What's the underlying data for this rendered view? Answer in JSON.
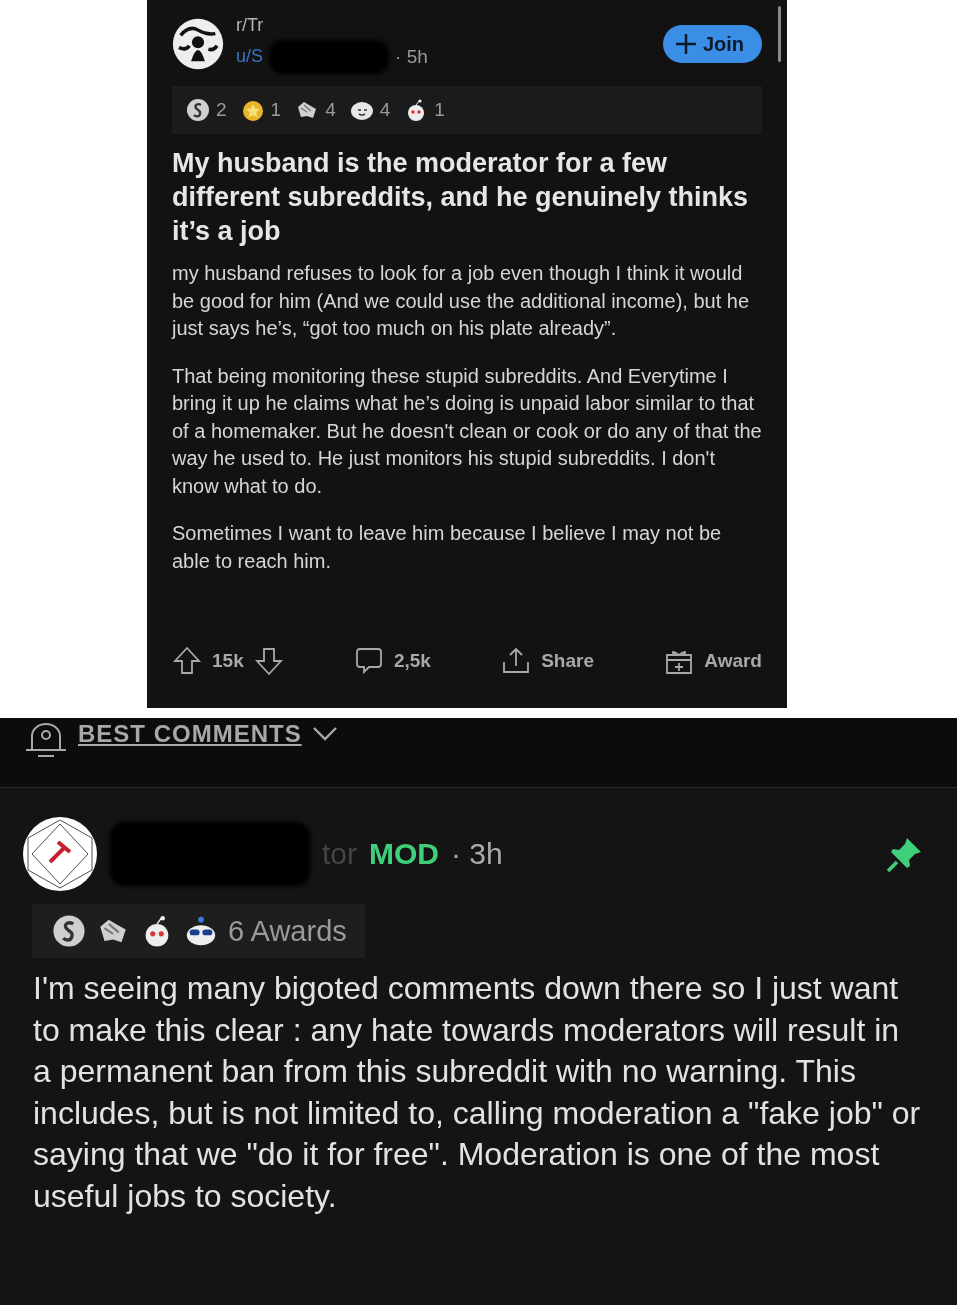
{
  "post": {
    "subreddit": "r/Tr",
    "author": "u/S",
    "time": "· 5h",
    "join_button": "Join",
    "awards": [
      {
        "kind": "silver",
        "count": "2"
      },
      {
        "kind": "star",
        "count": "1"
      },
      {
        "kind": "hands",
        "count": "4"
      },
      {
        "kind": "face",
        "count": "4"
      },
      {
        "kind": "snoo",
        "count": "1"
      }
    ],
    "title": "My husband is the moderator for a few different subreddits, and he genuinely thinks it’s a job",
    "paragraphs": [
      "my husband refuses to look for a job even though I think it would be good for him (And we could use the additional income), but he just says he’s, “got too much on his plate already”.",
      "That being monitoring these stupid subreddits. And Everytime I bring it up he claims what he’s doing is unpaid labor similar to that of a homemaker. But he doesn't clean or cook or do any of that the way he used to. He just monitors his stupid subreddits. I don't know what to do.",
      "Sometimes I want to leave him because I believe I may not be able to reach him."
    ],
    "actions": {
      "upvotes": "15k",
      "comments": "2,5k",
      "share": "Share",
      "award": "Award"
    }
  },
  "sort": {
    "label": "BEST COMMENTS"
  },
  "comment": {
    "author": "tor",
    "flair": "MOD",
    "time": "· 3h",
    "pinned": true,
    "awards": [
      {
        "kind": "silver"
      },
      {
        "kind": "hands"
      },
      {
        "kind": "snoo"
      },
      {
        "kind": "cool"
      }
    ],
    "award_count": "6 Awards",
    "body": "I'm seeing many bigoted comments down there so I just want to make this clear : any hate towards moderators will result in a permanent ban from this subreddit with no warning. This includes, but is not limited to, calling moderation a \"fake job\" or saying that we \"do it for free\". Moderation is one of the most useful jobs to society."
  }
}
